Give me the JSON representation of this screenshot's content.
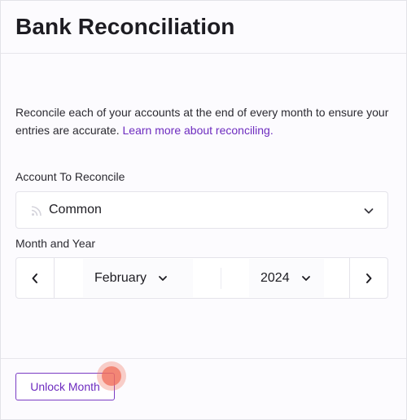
{
  "page": {
    "title": "Bank Reconciliation",
    "description": "Reconcile each of your accounts at the end of every month to ensure your entries are accurate.",
    "learn_more_link": "Learn more about reconciling."
  },
  "account_field": {
    "label": "Account To Reconcile",
    "selected": "Common",
    "icon": "rss-icon"
  },
  "month_year_field": {
    "label": "Month and Year",
    "month": "February",
    "year": "2024"
  },
  "footer": {
    "unlock_label": "Unlock Month"
  },
  "colors": {
    "accent": "#6d2bbf",
    "cursor": "#f06e5a"
  }
}
